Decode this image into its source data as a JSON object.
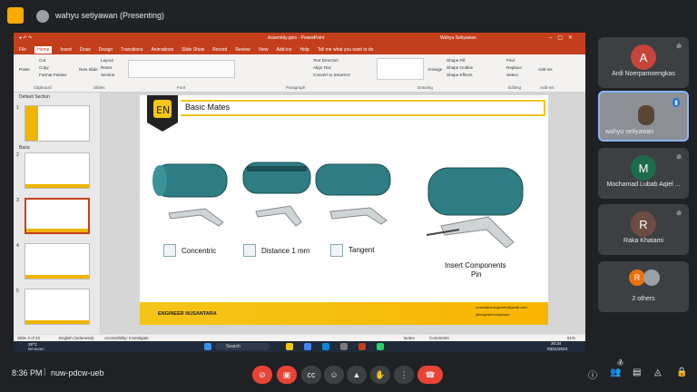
{
  "topbar": {
    "presenter": "wahyu setiyawan (Presenting)"
  },
  "ppt": {
    "title": "Assembly.pptx - PowerPoint",
    "user": "Wahyu Setiyawan",
    "tabs": [
      "File",
      "Home",
      "Insert",
      "Draw",
      "Design",
      "Transitions",
      "Animations",
      "Slide Show",
      "Record",
      "Review",
      "View",
      "Add-ins",
      "Help"
    ],
    "tell_me": "Tell me what you want to do",
    "clipboard": {
      "paste": "Paste",
      "cut": "Cut",
      "copy": "Copy",
      "format_painter": "Format Painter",
      "label": "Clipboard"
    },
    "slides_group": {
      "new_slide": "New Slide",
      "layout": "Layout",
      "reset": "Reset",
      "section": "Section",
      "label": "Slides"
    },
    "font_label": "Font",
    "paragraph_label": "Paragraph",
    "drawing_label": "Drawing",
    "editing_label": "Editing",
    "addins_label": "Add-ins",
    "text_direction": "Text Direction",
    "align_text": "Align Text",
    "convert_smartart": "Convert to SmartArt",
    "arrange": "Arrange",
    "quick_styles": "Quick Styles",
    "shape_fill": "Shape Fill",
    "shape_outline": "Shape Outline",
    "shape_effects": "Shape Effects",
    "find": "Find",
    "replace": "Replace",
    "select": "Select",
    "addins_btn": "Add-ins",
    "sections": {
      "default": "Default Section",
      "basic": "Basic"
    },
    "slide_numbers": [
      "1",
      "2",
      "3",
      "4",
      "5"
    ],
    "status": {
      "slide": "Slide 3 of 22",
      "language": "English (Indonesia)",
      "accessibility": "Accessibility: Investigate",
      "notes": "Notes",
      "comments": "Comments",
      "zoom": "61%"
    }
  },
  "slide": {
    "heading": "Basic Mates",
    "mates": [
      "Concentric",
      "Distance 1 mm",
      "Tangent"
    ],
    "insert_label_1": "Insert Components",
    "insert_label_2": "Pin",
    "brand": "ENGINEER NUSANTARA",
    "email": "nusantara.engineer@gmail.com",
    "handle": "@engineernusantara"
  },
  "taskbar": {
    "temp": "29°C",
    "weather": "Berawan",
    "search": "Search",
    "time": "20:34",
    "date": "03/11/2023"
  },
  "participants": [
    {
      "name": "Ardi Noerpamoengkas",
      "initial": "A",
      "color": "#c5453a"
    },
    {
      "name": "wahyu setiyawan",
      "initial": "",
      "color": "#5f6368"
    },
    {
      "name": "Mochamad Lubab Aqiel ...",
      "initial": "M",
      "color": "#1e6b4c"
    },
    {
      "name": "Raka Khatami",
      "initial": "R",
      "color": "#6d4c41"
    },
    {
      "name": "2 others",
      "initial": "R",
      "color": "#e8710a"
    }
  ],
  "bottom": {
    "time": "8:36 PM",
    "code": "nuw-pdcw-ueb",
    "people_count": "7"
  }
}
